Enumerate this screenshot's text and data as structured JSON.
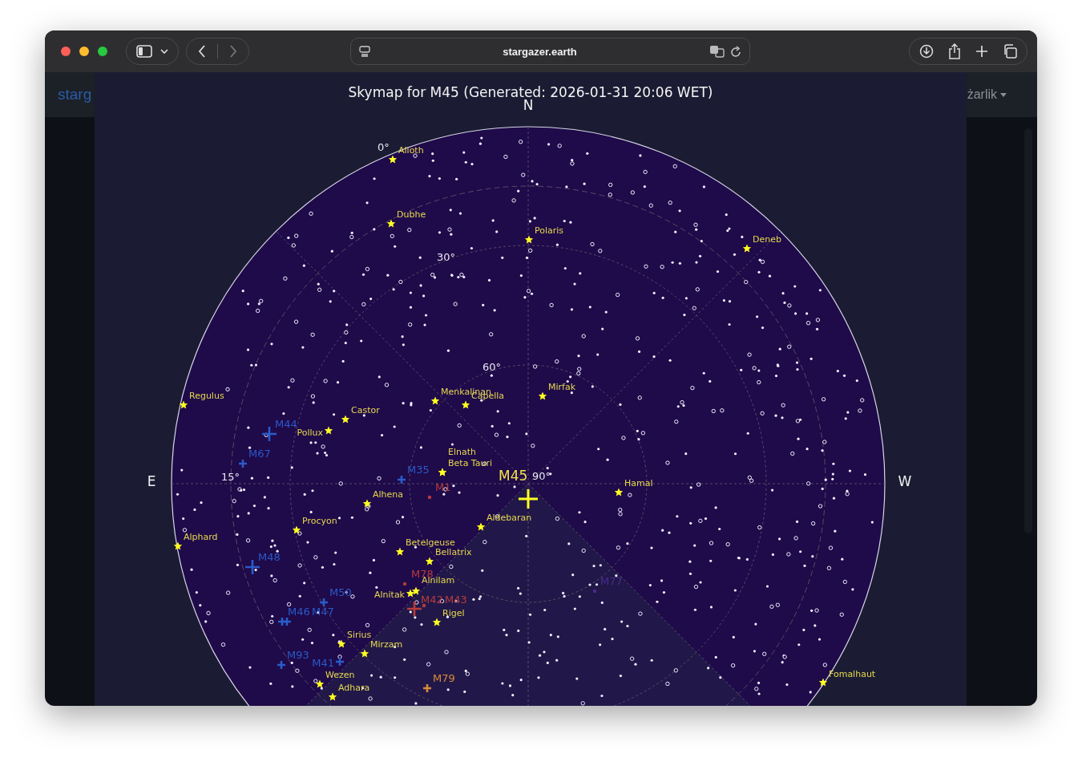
{
  "browser": {
    "url": "stargazer.earth"
  },
  "site_header": {
    "brand": "starg",
    "user_menu": "żarlik"
  },
  "skymap": {
    "title": "Skymap for M45 (Generated: 2026-01-31 20:06 WET)",
    "directions": [
      {
        "label": "N"
      },
      {
        "label": "E"
      },
      {
        "label": "W"
      }
    ],
    "altitude_labels": [
      "0°",
      "30°",
      "60°",
      "15°",
      "90°"
    ],
    "target": {
      "label": "M45"
    },
    "objects": [
      {
        "label": "Alioth",
        "kind": "star"
      },
      {
        "label": "Dubhe",
        "kind": "star"
      },
      {
        "label": "Polaris",
        "kind": "star"
      },
      {
        "label": "Deneb",
        "kind": "star"
      },
      {
        "label": "Regulus",
        "kind": "star"
      },
      {
        "label": "Castor",
        "kind": "star"
      },
      {
        "label": "Pollux",
        "kind": "star"
      },
      {
        "label": "Menkalinan",
        "kind": "star"
      },
      {
        "label": "Capella",
        "kind": "star"
      },
      {
        "label": "Mirfak",
        "kind": "star"
      },
      {
        "label": "Elnath",
        "kind": "star"
      },
      {
        "label": "Beta Tauri",
        "kind": "star"
      },
      {
        "label": "Alhena",
        "kind": "star"
      },
      {
        "label": "Hamal",
        "kind": "star"
      },
      {
        "label": "Procyon",
        "kind": "star"
      },
      {
        "label": "Aldebaran",
        "kind": "star"
      },
      {
        "label": "Alphard",
        "kind": "star"
      },
      {
        "label": "Betelgeuse",
        "kind": "star"
      },
      {
        "label": "Bellatrix",
        "kind": "star"
      },
      {
        "label": "Alnilam",
        "kind": "star"
      },
      {
        "label": "Alnitak",
        "kind": "star"
      },
      {
        "label": "Rigel",
        "kind": "star"
      },
      {
        "label": "Sirius",
        "kind": "star"
      },
      {
        "label": "Mirzam",
        "kind": "star"
      },
      {
        "label": "Wezen",
        "kind": "star"
      },
      {
        "label": "Adhara",
        "kind": "star"
      },
      {
        "label": "Fomalhaut",
        "kind": "star"
      },
      {
        "label": "M44",
        "kind": "messier",
        "color": "#2a5bc8"
      },
      {
        "label": "M67",
        "kind": "messier",
        "color": "#2a5bc8"
      },
      {
        "label": "M35",
        "kind": "messier",
        "color": "#2a5bc8"
      },
      {
        "label": "M1",
        "kind": "messier",
        "color": "#b83c3c"
      },
      {
        "label": "M48",
        "kind": "messier",
        "color": "#2a5bc8"
      },
      {
        "label": "M50",
        "kind": "messier",
        "color": "#2a5bc8"
      },
      {
        "label": "M46",
        "kind": "messier",
        "color": "#2a5bc8"
      },
      {
        "label": "M47",
        "kind": "messier",
        "color": "#2a5bc8"
      },
      {
        "label": "M93",
        "kind": "messier",
        "color": "#2a5bc8"
      },
      {
        "label": "M41",
        "kind": "messier",
        "color": "#2a5bc8"
      },
      {
        "label": "M78",
        "kind": "messier",
        "color": "#b83c3c"
      },
      {
        "label": "M42",
        "kind": "messier",
        "color": "#b83c3c"
      },
      {
        "label": "M43",
        "kind": "messier",
        "color": "#b83c3c"
      },
      {
        "label": "M79",
        "kind": "messier",
        "color": "#d98a3a"
      },
      {
        "label": "M77",
        "kind": "messier",
        "color": "#4a2a90"
      }
    ]
  }
}
